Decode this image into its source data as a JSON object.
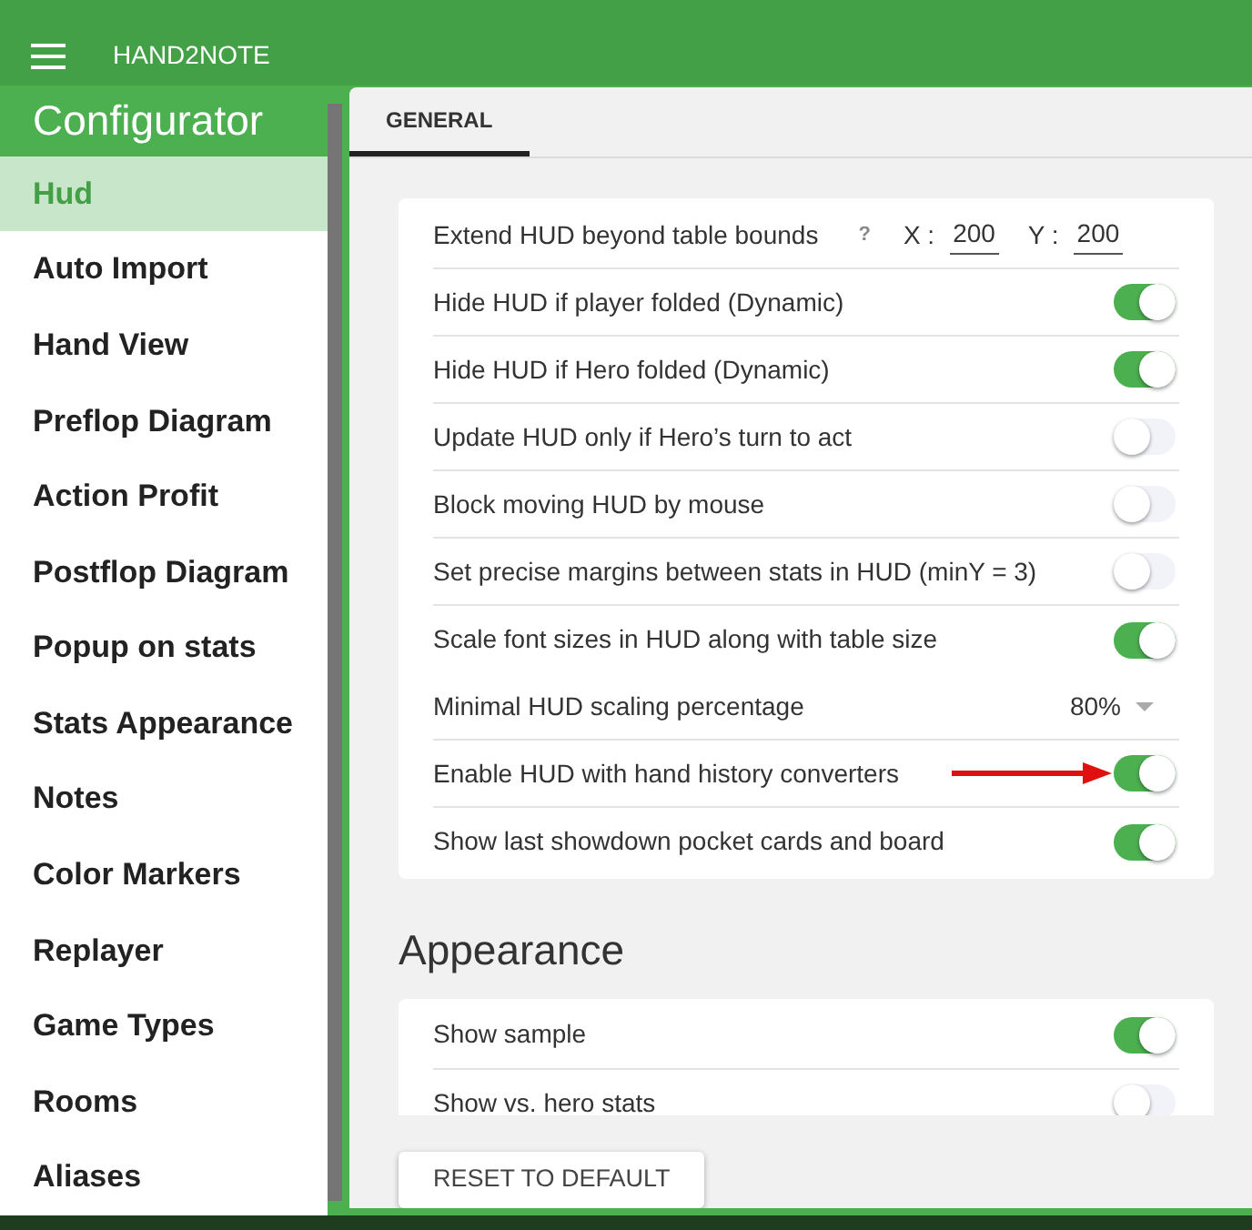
{
  "app_bar": {
    "title": "HAND2NOTE"
  },
  "sidebar": {
    "title": "Configurator",
    "items": [
      {
        "label": "Hud",
        "selected": true
      },
      {
        "label": "Auto Import",
        "selected": false
      },
      {
        "label": "Hand View",
        "selected": false
      },
      {
        "label": "Preflop Diagram",
        "selected": false
      },
      {
        "label": "Action Profit",
        "selected": false
      },
      {
        "label": "Postflop Diagram",
        "selected": false
      },
      {
        "label": "Popup on stats",
        "selected": false
      },
      {
        "label": "Stats Appearance",
        "selected": false
      },
      {
        "label": "Notes",
        "selected": false
      },
      {
        "label": "Color Markers",
        "selected": false
      },
      {
        "label": "Replayer",
        "selected": false
      },
      {
        "label": "Game Types",
        "selected": false
      },
      {
        "label": "Rooms",
        "selected": false
      },
      {
        "label": "Aliases",
        "selected": false
      }
    ]
  },
  "tabs": [
    {
      "label": "GENERAL",
      "selected": true
    }
  ],
  "general_settings": [
    {
      "kind": "bounds",
      "label": "Extend HUD beyond table bounds",
      "help": "?",
      "x_label": "X :",
      "x_value": "200",
      "y_label": "Y :",
      "y_value": "200"
    },
    {
      "kind": "toggle",
      "label": "Hide HUD if player folded (Dynamic)",
      "on": true
    },
    {
      "kind": "toggle",
      "label": "Hide HUD if Hero folded (Dynamic)",
      "on": true
    },
    {
      "kind": "toggle",
      "label": "Update HUD only if Hero’s turn to act",
      "on": false
    },
    {
      "kind": "toggle",
      "label": "Block moving HUD by mouse",
      "on": false
    },
    {
      "kind": "toggle",
      "label": "Set precise margins between stats in HUD (minY = 3)",
      "on": false
    },
    {
      "kind": "toggle",
      "label": "Scale font sizes in HUD along with table size",
      "on": true,
      "nodivider": true
    },
    {
      "kind": "select",
      "label": "Minimal HUD scaling percentage",
      "value": "80%"
    },
    {
      "kind": "toggle",
      "label": "Enable HUD with hand history converters",
      "on": true,
      "arrow": true
    },
    {
      "kind": "toggle",
      "label": "Show last showdown pocket cards and board",
      "on": true
    }
  ],
  "appearance": {
    "heading": "Appearance",
    "settings": [
      {
        "kind": "toggle",
        "label": "Show sample",
        "on": true
      },
      {
        "kind": "toggle",
        "label": "Show vs. hero stats",
        "on": false
      }
    ]
  },
  "reset_button": "RESET TO DEFAULT"
}
